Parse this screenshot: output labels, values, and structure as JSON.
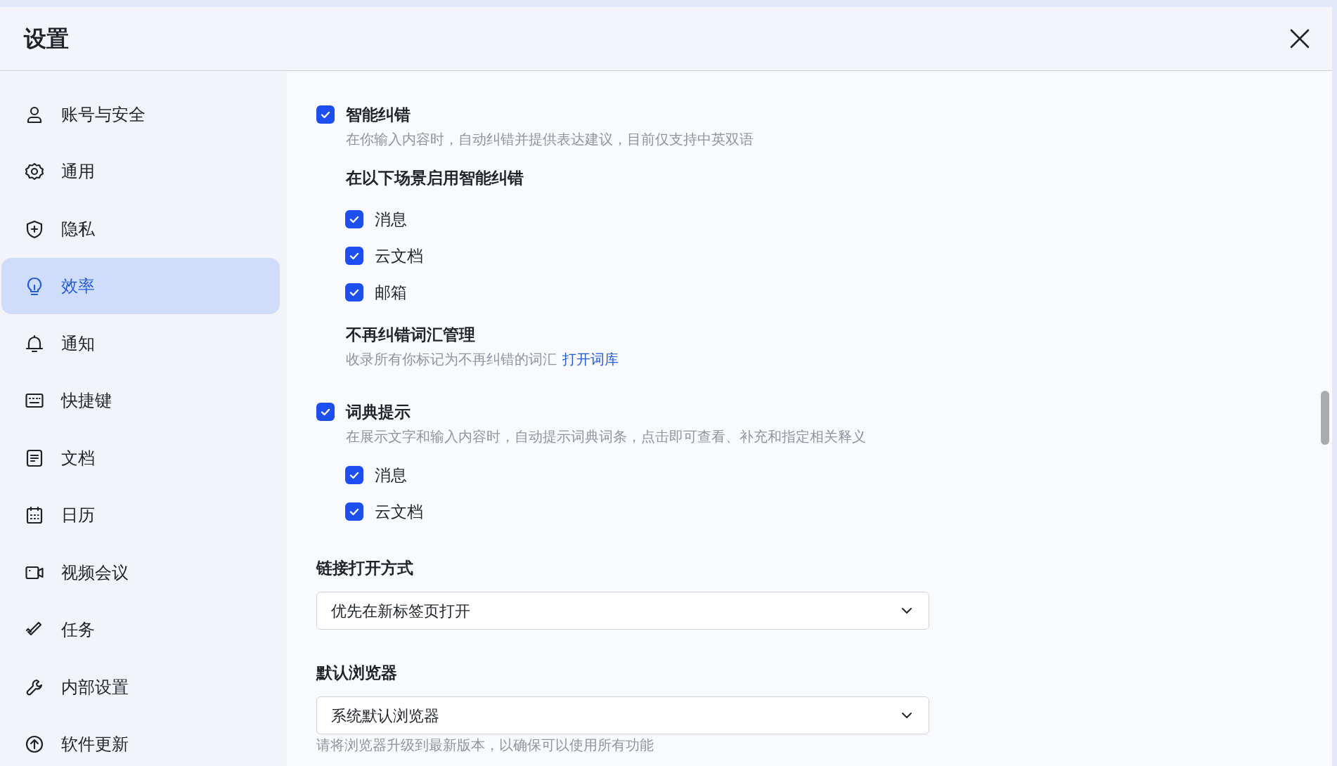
{
  "window": {
    "title": "设置"
  },
  "sidebar": {
    "items": [
      {
        "label": "账号与安全",
        "selected": false
      },
      {
        "label": "通用",
        "selected": false
      },
      {
        "label": "隐私",
        "selected": false
      },
      {
        "label": "效率",
        "selected": true
      },
      {
        "label": "通知",
        "selected": false
      },
      {
        "label": "快捷键",
        "selected": false
      },
      {
        "label": "文档",
        "selected": false
      },
      {
        "label": "日历",
        "selected": false
      },
      {
        "label": "视频会议",
        "selected": false
      },
      {
        "label": "任务",
        "selected": false
      },
      {
        "label": "内部设置",
        "selected": false
      },
      {
        "label": "软件更新",
        "selected": false
      }
    ]
  },
  "content": [
    {
      "kind": "checkbox",
      "label": "智能纠错",
      "checked": true,
      "description": "在你输入内容时，自动纠错并提供表达建议，目前仅支持中英双语"
    },
    {
      "kind": "subheading",
      "label": "在以下场景启用智能纠错"
    },
    {
      "kind": "option",
      "label": "消息",
      "checked": true
    },
    {
      "kind": "option",
      "label": "云文档",
      "checked": true
    },
    {
      "kind": "option",
      "label": "邮箱",
      "checked": true
    },
    {
      "kind": "link_setting",
      "label": "不再纠错词汇管理",
      "description": "收录所有你标记为不再纠错的词汇",
      "link": "打开词库"
    },
    {
      "kind": "checkbox",
      "label": "词典提示",
      "checked": true,
      "description": "在展示文字和输入内容时，自动提示词典词条，点击即可查看、补充和指定相关释义"
    },
    {
      "kind": "option",
      "label": "消息",
      "checked": true
    },
    {
      "kind": "option",
      "label": "云文档",
      "checked": true
    },
    {
      "kind": "select",
      "label": "链接打开方式",
      "value": "优先在新标签页打开"
    },
    {
      "kind": "select",
      "label": "默认浏览器",
      "value": "系统默认浏览器",
      "note": "请将浏览器升级到最新版本，以确保可以使用所有功能"
    }
  ]
}
